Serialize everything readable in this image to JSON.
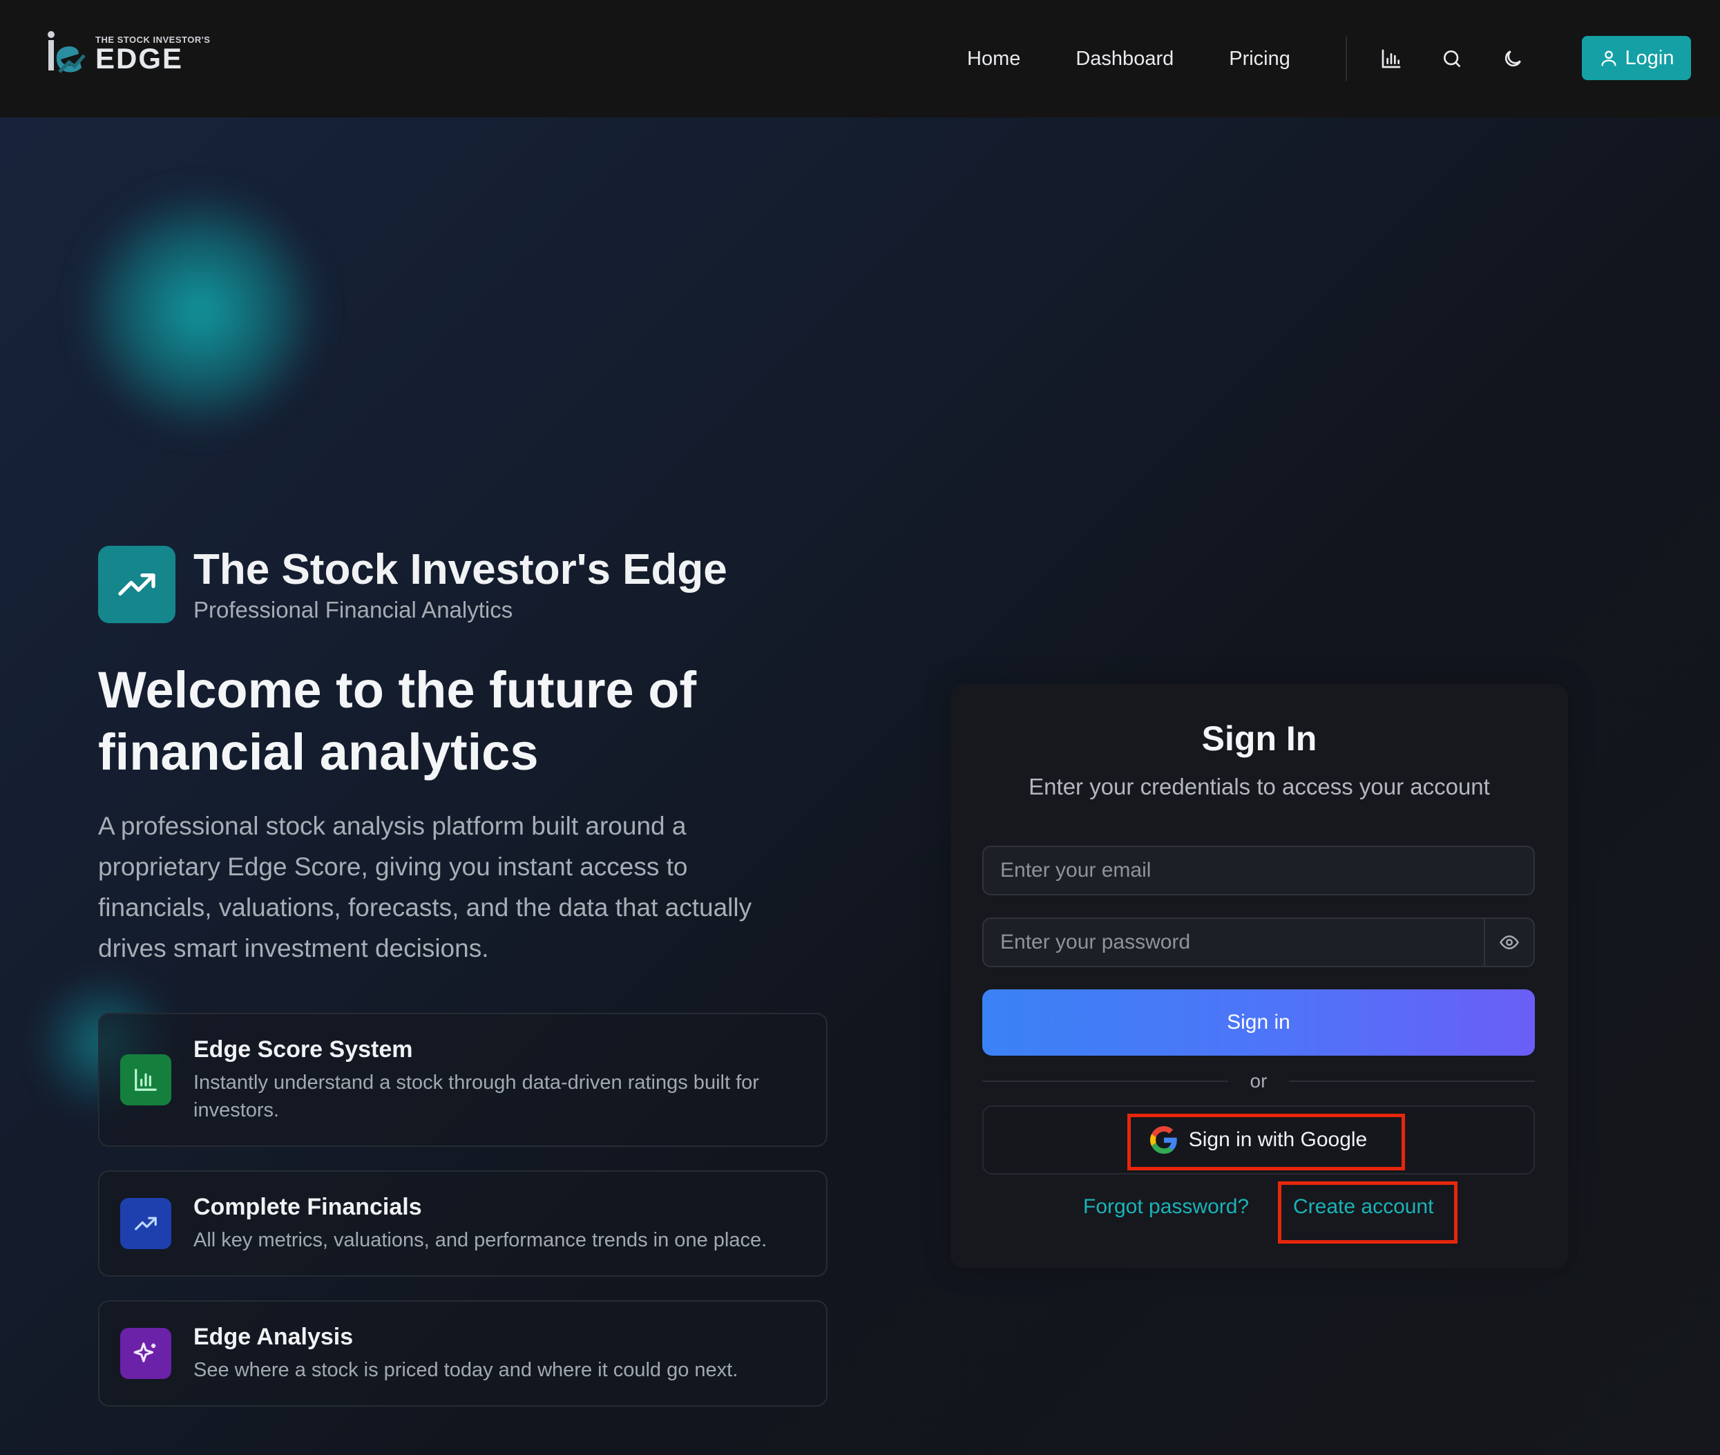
{
  "header": {
    "logo_small": "THE STOCK INVESTOR'S",
    "logo_big": "EDGE",
    "nav": [
      "Home",
      "Dashboard",
      "Pricing"
    ],
    "icons": [
      "bar-chart-icon",
      "search-icon",
      "moon-icon"
    ],
    "login_label": "Login"
  },
  "brand": {
    "title": "The Stock Investor's Edge",
    "subtitle": "Professional Financial Analytics"
  },
  "hero": {
    "title": "Welcome to the future of financial analytics",
    "description": "A professional stock analysis platform built around a proprietary Edge Score, giving you instant access to financials, valuations, forecasts, and the data that actually drives smart investment decisions."
  },
  "features": [
    {
      "title": "Edge Score System",
      "description": "Instantly understand a stock through data-driven ratings built for investors.",
      "icon": "bar-chart-icon",
      "color": "#15803d"
    },
    {
      "title": "Complete Financials",
      "description": "All key metrics, valuations, and performance trends in one place.",
      "icon": "trending-up-icon",
      "color": "#1e40af"
    },
    {
      "title": "Edge Analysis",
      "description": "See where a stock is priced today and where it could go next.",
      "icon": "sparkle-icon",
      "color": "#6b21a8"
    }
  ],
  "signin": {
    "title": "Sign In",
    "subtitle": "Enter your credentials to access your account",
    "email_placeholder": "Enter your email",
    "password_placeholder": "Enter your password",
    "submit_label": "Sign in",
    "or_label": "or",
    "google_label": "Sign in with Google",
    "forgot_label": "Forgot password?",
    "create_label": "Create account"
  },
  "colors": {
    "accent": "#14a0a5",
    "highlight": "#e8260c",
    "button_gradient_start": "#3b82f6",
    "button_gradient_end": "#6a5ef7"
  }
}
